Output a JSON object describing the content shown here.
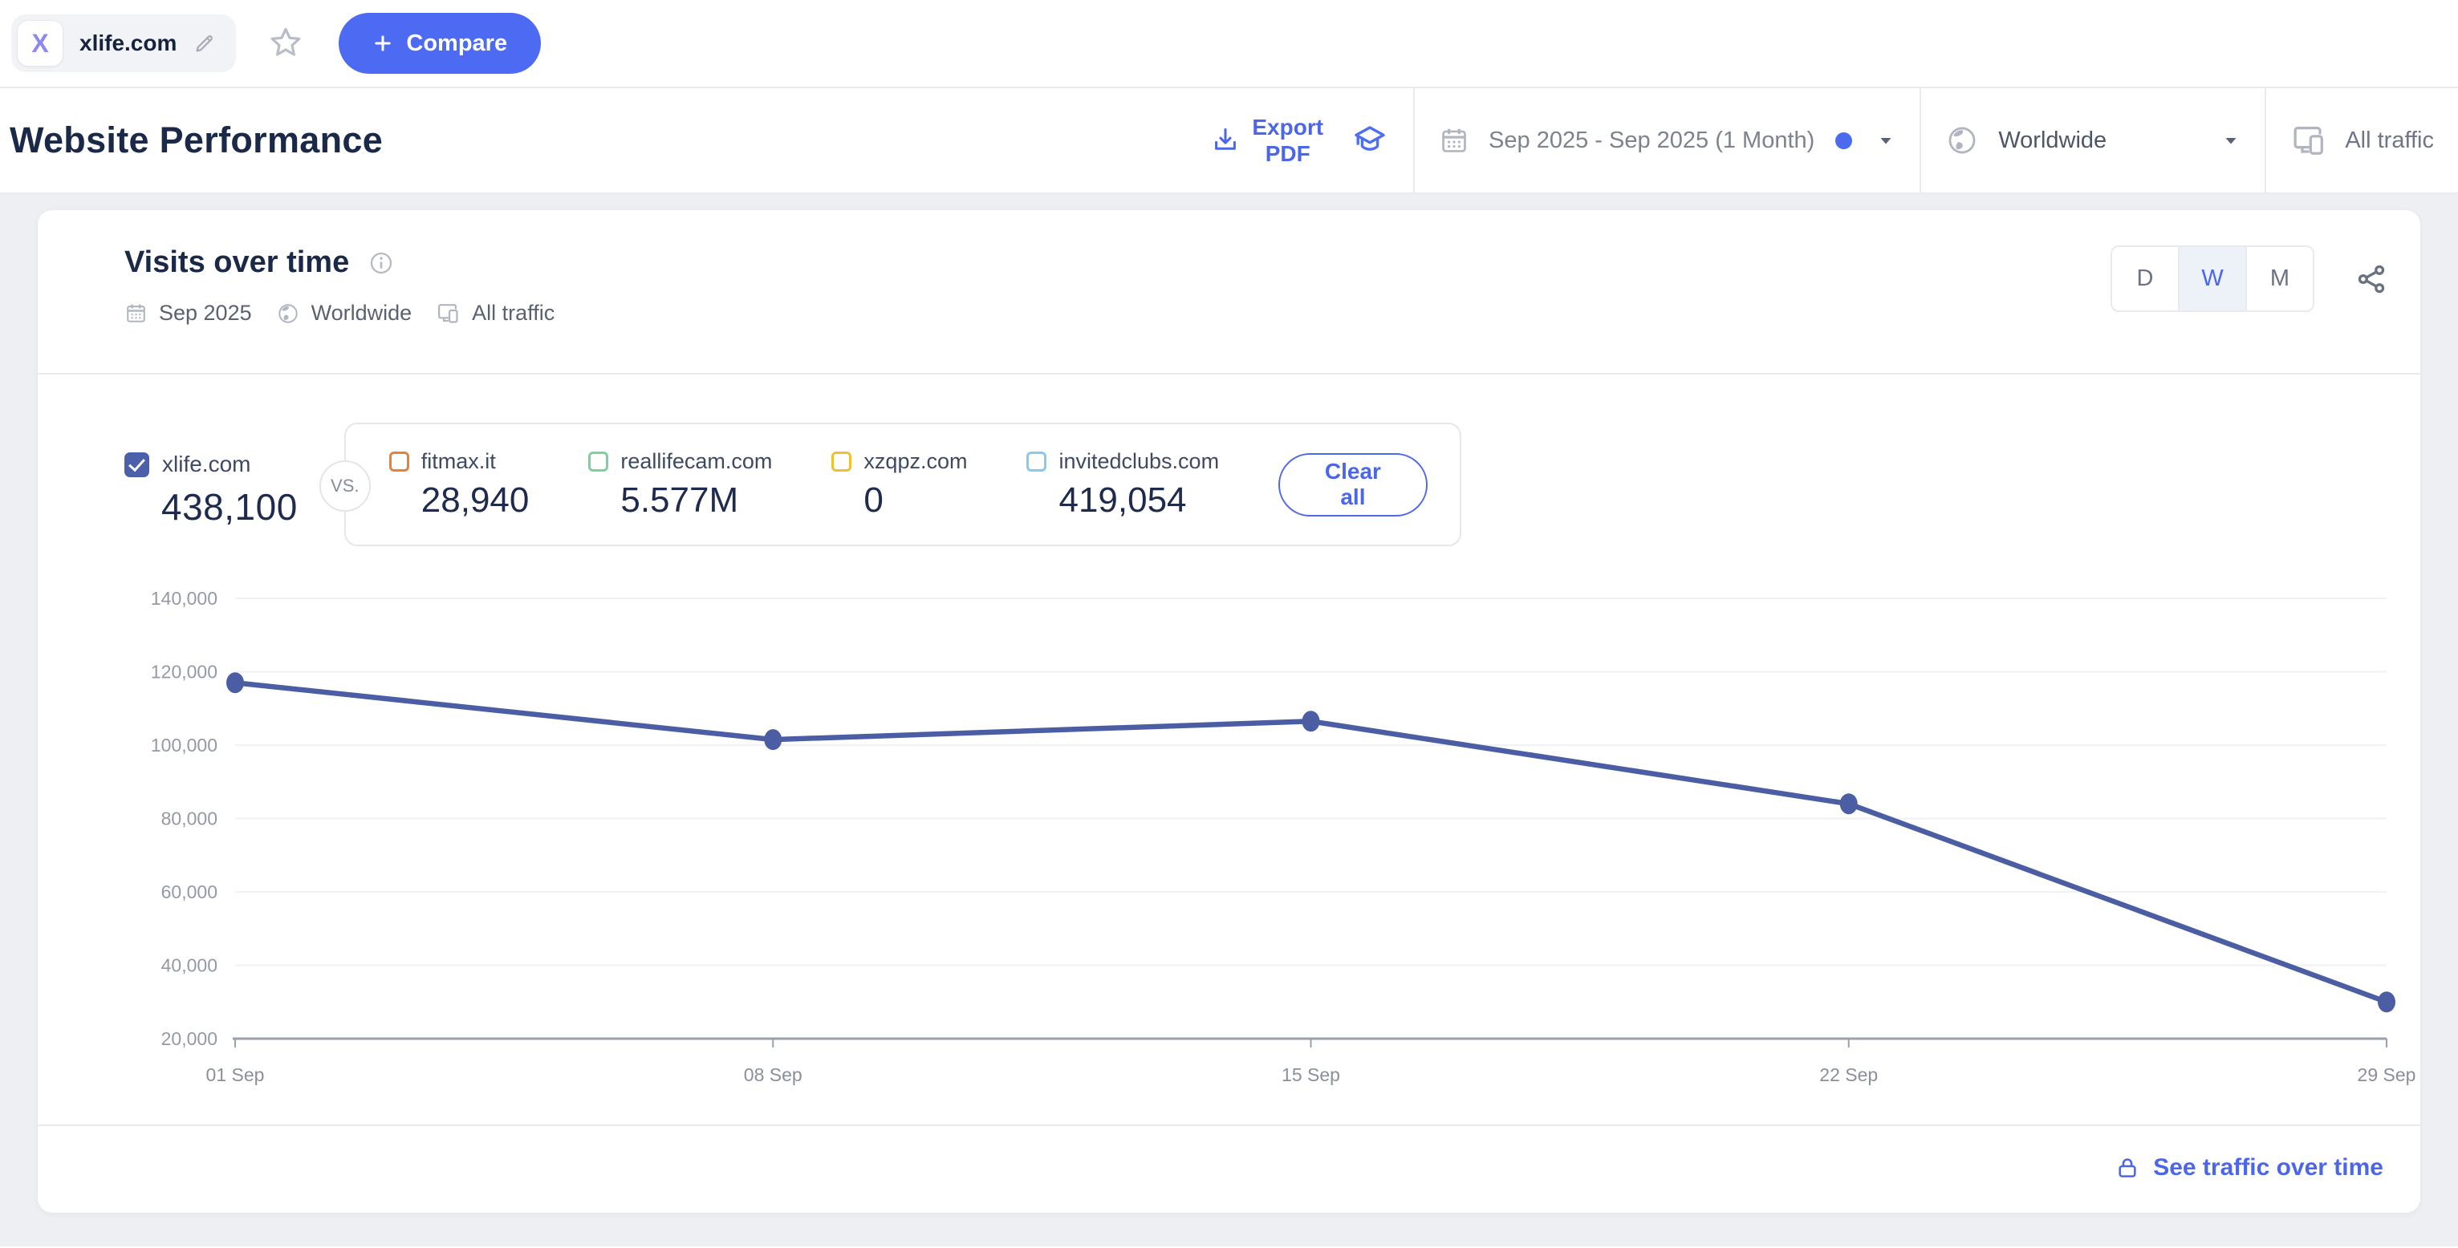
{
  "topbar": {
    "logo_letter": "X",
    "site_name": "xlife.com",
    "compare_label": "Compare"
  },
  "header": {
    "title": "Website Performance",
    "export_pdf": {
      "line1": "Export",
      "line2": "PDF"
    },
    "date_selector": "Sep 2025 - Sep 2025 (1 Month)",
    "region_selector": "Worldwide",
    "traffic_selector": "All traffic"
  },
  "card": {
    "title": "Visits over time",
    "meta": {
      "date": "Sep 2025",
      "region": "Worldwide",
      "traffic": "All traffic"
    },
    "granularity": {
      "options": [
        "D",
        "W",
        "M"
      ],
      "active": "W"
    },
    "legend": {
      "main": {
        "name": "xlife.com",
        "value": "438,100"
      },
      "vs_label": "VS.",
      "competitors": [
        {
          "name": "fitmax.it",
          "value": "28,940",
          "color": "#e2823b"
        },
        {
          "name": "reallifecam.com",
          "value": "5.577M",
          "color": "#7ed09e"
        },
        {
          "name": "xzqpz.com",
          "value": "0",
          "color": "#eec032"
        },
        {
          "name": "invitedclubs.com",
          "value": "419,054",
          "color": "#84cbec"
        }
      ],
      "clear_all_label": "Clear all"
    },
    "footer_link": "See traffic over time"
  },
  "chart_data": {
    "type": "line",
    "title": "Visits over time",
    "x": [
      "01 Sep",
      "08 Sep",
      "15 Sep",
      "22 Sep",
      "29 Sep"
    ],
    "series": [
      {
        "name": "xlife.com",
        "color": "#4b5ea4",
        "values": [
          117000,
          101500,
          106500,
          84000,
          30000
        ]
      }
    ],
    "y_ticks": [
      140000,
      120000,
      100000,
      80000,
      60000,
      40000,
      20000
    ],
    "ylim": [
      20000,
      140000
    ],
    "xlabel": "",
    "ylabel": "",
    "grid": "horizontal",
    "legend_position": "top"
  },
  "colors": {
    "accent": "#4c66e8",
    "compare_button": "#4d6bf2",
    "line": "#4b5ea4",
    "main_checkbox": "#4c5fab",
    "date_dot": "#4a6bee",
    "logo_purple": "#8d87f4"
  },
  "icons": [
    "x-logo",
    "edit-pencil",
    "star",
    "plus",
    "download",
    "academy-cap",
    "calendar",
    "globe",
    "devices",
    "chevron-down",
    "info",
    "share",
    "lock"
  ]
}
